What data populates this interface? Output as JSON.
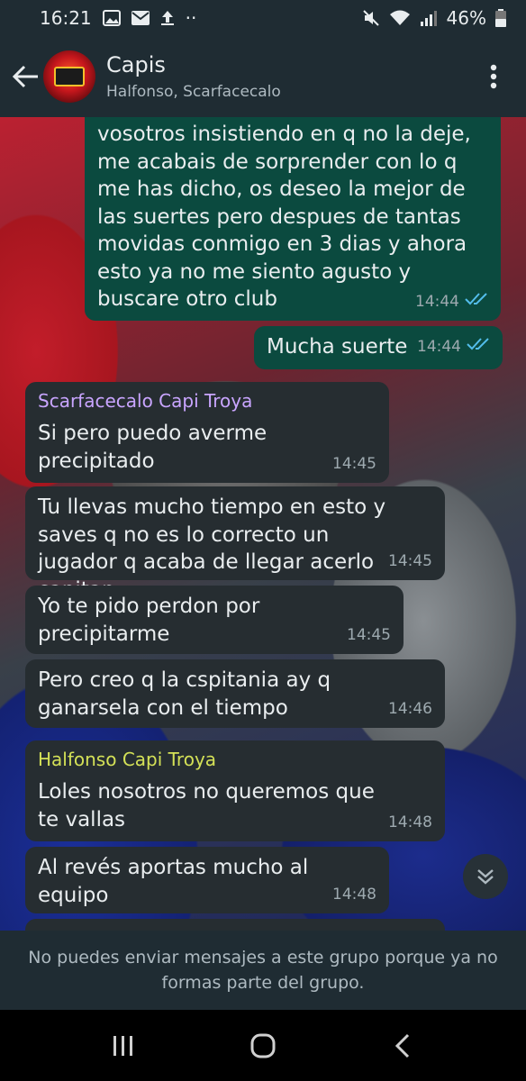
{
  "status_bar": {
    "time": "16:21",
    "dots": "··",
    "battery": "46%"
  },
  "header": {
    "title": "Capis",
    "subtitle": "Halfonso, Scarfacecalo"
  },
  "messages": [
    {
      "direction": "out",
      "text": "vosotros insistiendo en q no la deje, me acabais de sorprender con lo q me has dicho, os deseo la mejor de las suertes pero despues de tantas movidas conmigo en 3 dias y ahora esto ya no me siento agusto y buscare otro club",
      "time": "14:44"
    },
    {
      "direction": "out",
      "text": "Mucha suerte",
      "time": "14:44"
    },
    {
      "direction": "in",
      "sender": "Scarfacecalo Capi Troya",
      "text": "Si pero puedo averme precipitado",
      "time": "14:45"
    },
    {
      "direction": "in",
      "text": "Tu llevas mucho tiempo en esto y saves q no es lo correcto un jugador q acaba de llegar acerlo capitan",
      "time": "14:45"
    },
    {
      "direction": "in",
      "text": "Yo te pido perdon por precipitarme",
      "time": "14:45"
    },
    {
      "direction": "in",
      "text": "Pero creo q la cspitania ay q ganarsela con el tiempo",
      "time": "14:46"
    },
    {
      "direction": "in",
      "sender": "Halfonso Capi Troya",
      "text": "Loles nosotros no queremos que te vallas",
      "time": "14:48"
    },
    {
      "direction": "in",
      "text": "Al revés aportas mucho al equipo",
      "time": "14:48"
    }
  ],
  "notice": "No puedes enviar mensajes a este grupo porque ya no formas parte del grupo.",
  "colors": {
    "header_bg": "#1f2c33",
    "out_bubble": "#0b4a3f",
    "in_bubble": "#262d31",
    "read_ticks": "#53bdeb",
    "sender_1": "#c9a5ff",
    "sender_2": "#d4e157"
  },
  "icons": {
    "status": [
      "image-icon",
      "mail-icon",
      "upload-icon",
      "mute-icon",
      "wifi-icon",
      "signal-icon",
      "battery-icon"
    ],
    "header": [
      "back-arrow-icon",
      "group-avatar",
      "more-vert-icon"
    ],
    "chat": [
      "double-check-icon",
      "scroll-down-icon"
    ],
    "nav": [
      "recents-icon",
      "home-icon",
      "back-icon"
    ]
  }
}
